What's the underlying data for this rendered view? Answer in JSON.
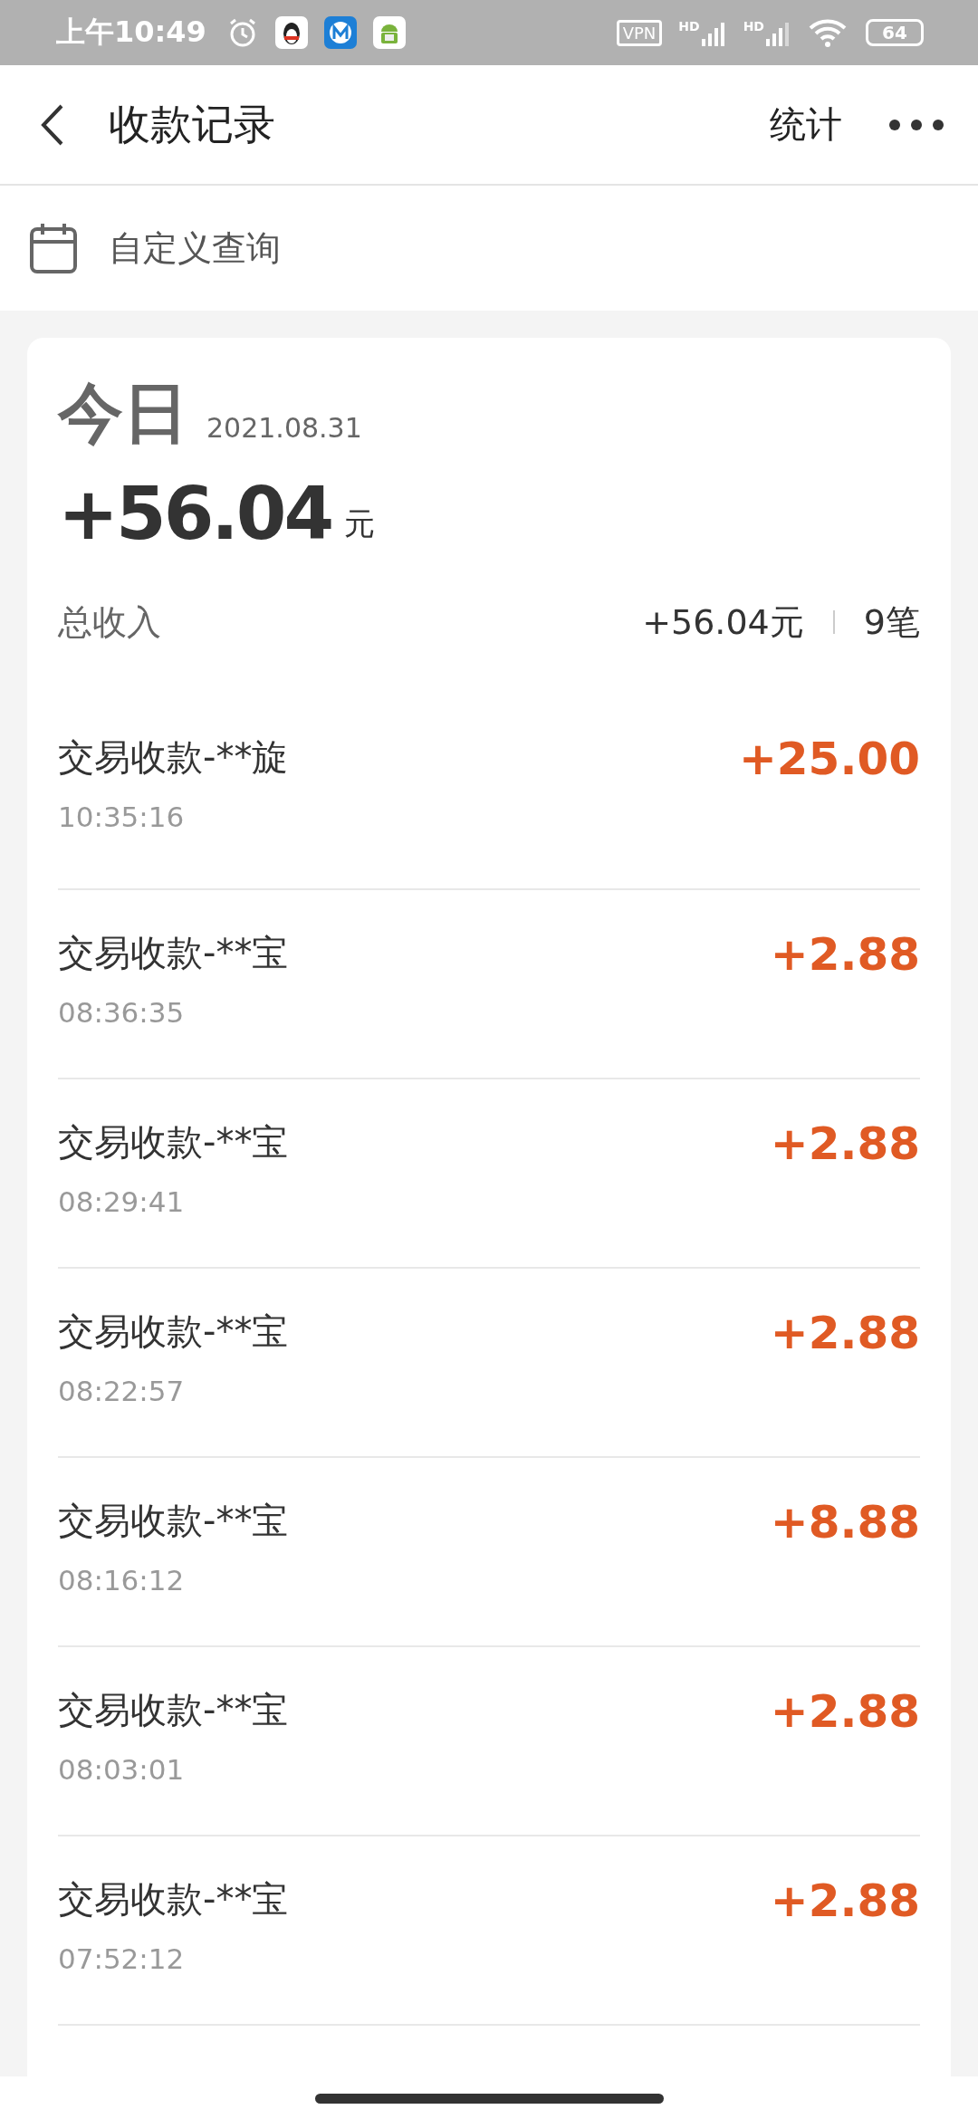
{
  "status_bar": {
    "time": "上午10:49",
    "vpn": "VPN",
    "signals": [
      "HD",
      "HD"
    ],
    "battery": "64"
  },
  "header": {
    "title": "收款记录",
    "action": "统计"
  },
  "query": {
    "label": "自定义查询"
  },
  "summary": {
    "day": "今日",
    "date": "2021.08.31",
    "amount": "+56.04",
    "unit": "元",
    "label": "总收入",
    "total": "+56.04元",
    "count": "9笔"
  },
  "records": [
    {
      "title": "交易收款-**旋",
      "time": "10:35:16",
      "amount": "+25.00"
    },
    {
      "title": "交易收款-**宝",
      "time": "08:36:35",
      "amount": "+2.88"
    },
    {
      "title": "交易收款-**宝",
      "time": "08:29:41",
      "amount": "+2.88"
    },
    {
      "title": "交易收款-**宝",
      "time": "08:22:57",
      "amount": "+2.88"
    },
    {
      "title": "交易收款-**宝",
      "time": "08:16:12",
      "amount": "+8.88"
    },
    {
      "title": "交易收款-**宝",
      "time": "08:03:01",
      "amount": "+2.88"
    },
    {
      "title": "交易收款-**宝",
      "time": "07:52:12",
      "amount": "+2.88"
    }
  ]
}
